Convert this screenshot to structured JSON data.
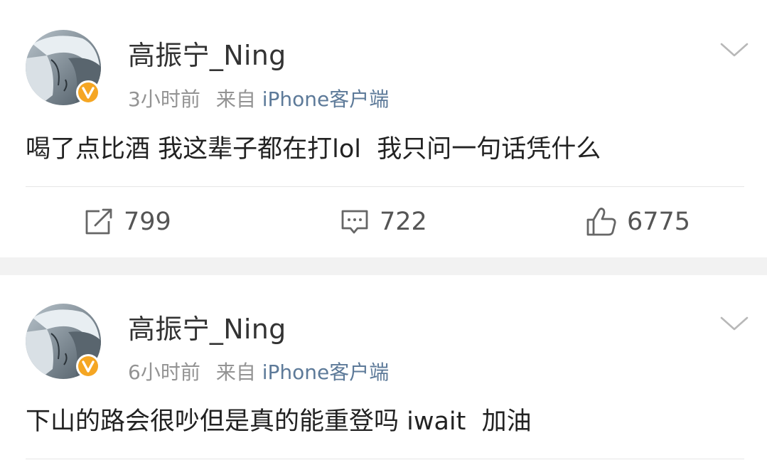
{
  "posts": [
    {
      "username": "高振宁_Ning",
      "time": "3小时前",
      "source_prefix": "来自",
      "source": "iPhone客户端",
      "content": "喝了点比酒 我这辈子都在打lol  我只问一句话凭什么",
      "reposts": "799",
      "comments": "722",
      "likes": "6775"
    },
    {
      "username": "高振宁_Ning",
      "time": "6小时前",
      "source_prefix": "来自",
      "source": "iPhone客户端",
      "content": "下山的路会很吵但是真的能重登吗 iwait  加油"
    }
  ],
  "icons": {
    "verified_badge": "verified-badge-icon",
    "menu": "chevron-down-icon",
    "repost": "repost-icon",
    "comment": "comment-icon",
    "like": "thumbs-up-icon"
  },
  "colors": {
    "background": "#f2f2f2",
    "card": "#ffffff",
    "text": "#333333",
    "muted": "#939393",
    "source_link": "#5d7a99",
    "badge": "#f5a623"
  }
}
